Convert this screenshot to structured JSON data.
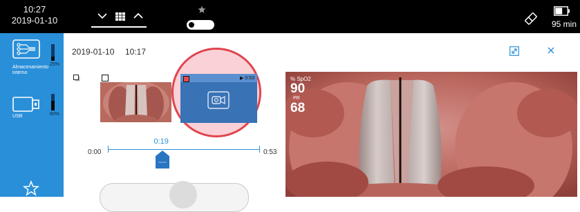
{
  "status_bar": {
    "time": "10:27",
    "date": "2019-01-10",
    "battery_text": "95 min",
    "battery_level": 0.6
  },
  "sidebar": {
    "items": [
      {
        "label": "Almacenamiento interno",
        "percent": "25%",
        "level": 0.25,
        "icon": "internal-storage-icon"
      },
      {
        "label": "USB",
        "percent": "60%",
        "level": 0.6,
        "icon": "usb-drive-icon"
      }
    ],
    "favorites_icon": "star-icon"
  },
  "header": {
    "date": "2019-01-10",
    "time": "10:17"
  },
  "thumbnails": {
    "video_duration": "▶ 0:53"
  },
  "timeline": {
    "start": "0:00",
    "current": "0:19",
    "end": "0:53",
    "progress": 0.36
  },
  "live_view": {
    "spo2_label": "% SpO2",
    "spo2_value": "90",
    "pr_label": "PR",
    "pr_value": "68"
  },
  "colors": {
    "accent": "#2a8fd9",
    "highlight": "#e0444e",
    "video_thumb": "#3973b5"
  }
}
